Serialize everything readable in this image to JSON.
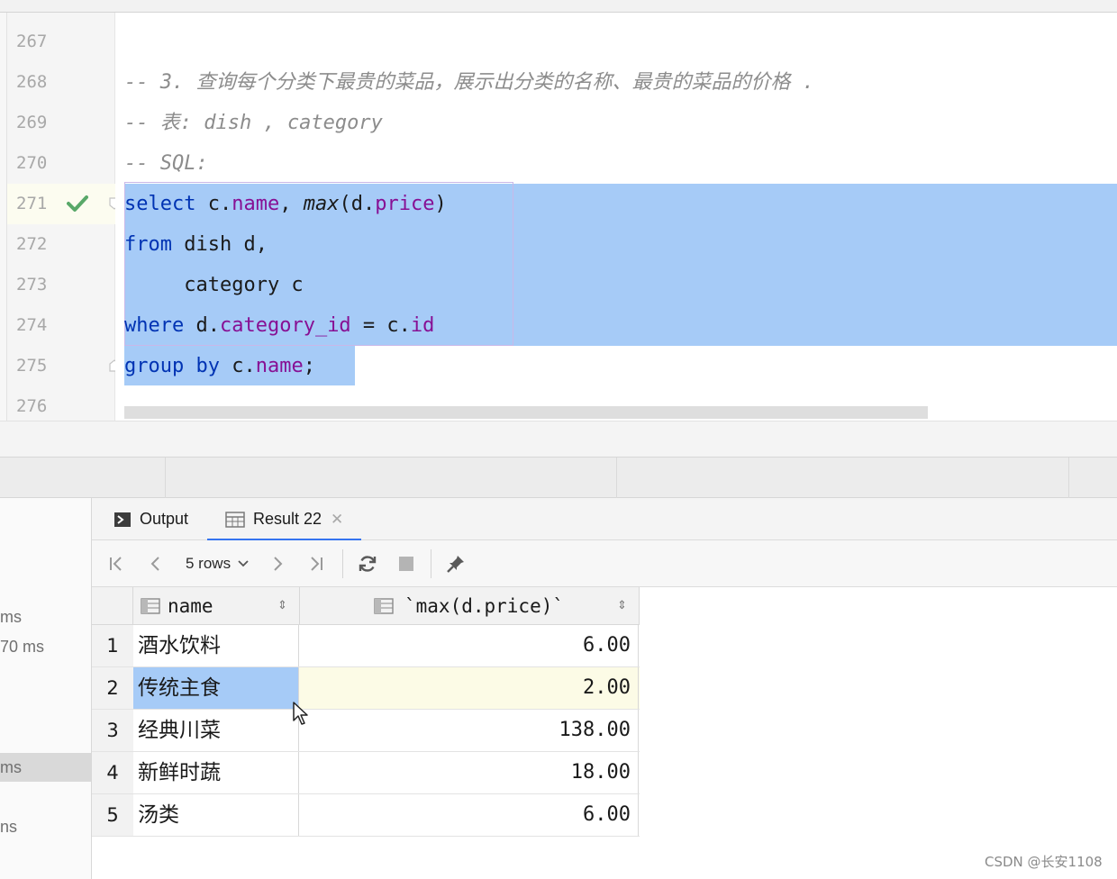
{
  "editor": {
    "line_numbers": [
      "267",
      "268",
      "269",
      "270",
      "271",
      "272",
      "273",
      "274",
      "275",
      "276"
    ],
    "comment_line_1": "-- 3. 查询每个分类下最贵的菜品，展示出分类的名称、最贵的菜品的价格 .",
    "comment_line_2": "-- 表: dish , category",
    "comment_line_3": "-- SQL:",
    "sql": {
      "select_kw": "select",
      "alias_c": "c.",
      "name_field": "name",
      "comma": ", ",
      "max_fn": "max",
      "open_paren": "(d.",
      "price_field": "price",
      "close_paren": ")",
      "from_kw": "from",
      "from_rest": " dish d,",
      "category_line": "     category c",
      "where_kw": "where",
      "alias_d": " d.",
      "category_id_field": "category_id",
      "equals": " = c.",
      "id_field": "id",
      "group_kw": "group",
      "by_kw": "by",
      "semicolon": ";"
    }
  },
  "results": {
    "tabs": [
      {
        "label": "Output"
      },
      {
        "label": "Result 22"
      }
    ],
    "rows_selector": "5 rows",
    "columns": [
      "name",
      "`max(d.price)`"
    ],
    "rows": [
      {
        "n": "1",
        "name": "酒水饮料",
        "price": "6.00"
      },
      {
        "n": "2",
        "name": "传统主食",
        "price": "2.00"
      },
      {
        "n": "3",
        "name": "经典川菜",
        "price": "138.00"
      },
      {
        "n": "4",
        "name": "新鲜时蔬",
        "price": "18.00"
      },
      {
        "n": "5",
        "name": "汤类",
        "price": "6.00"
      }
    ]
  },
  "services_panel": {
    "items": [
      "ms",
      "70 ms",
      "ms",
      "ns"
    ]
  },
  "watermark": "CSDN @长安1108",
  "colors": {
    "selection": "#a6cbf7",
    "keyword": "#0033b3",
    "field": "#871094",
    "comment": "#8c8c8c",
    "check": "#59a869",
    "active_tab_underline": "#3574f0"
  }
}
